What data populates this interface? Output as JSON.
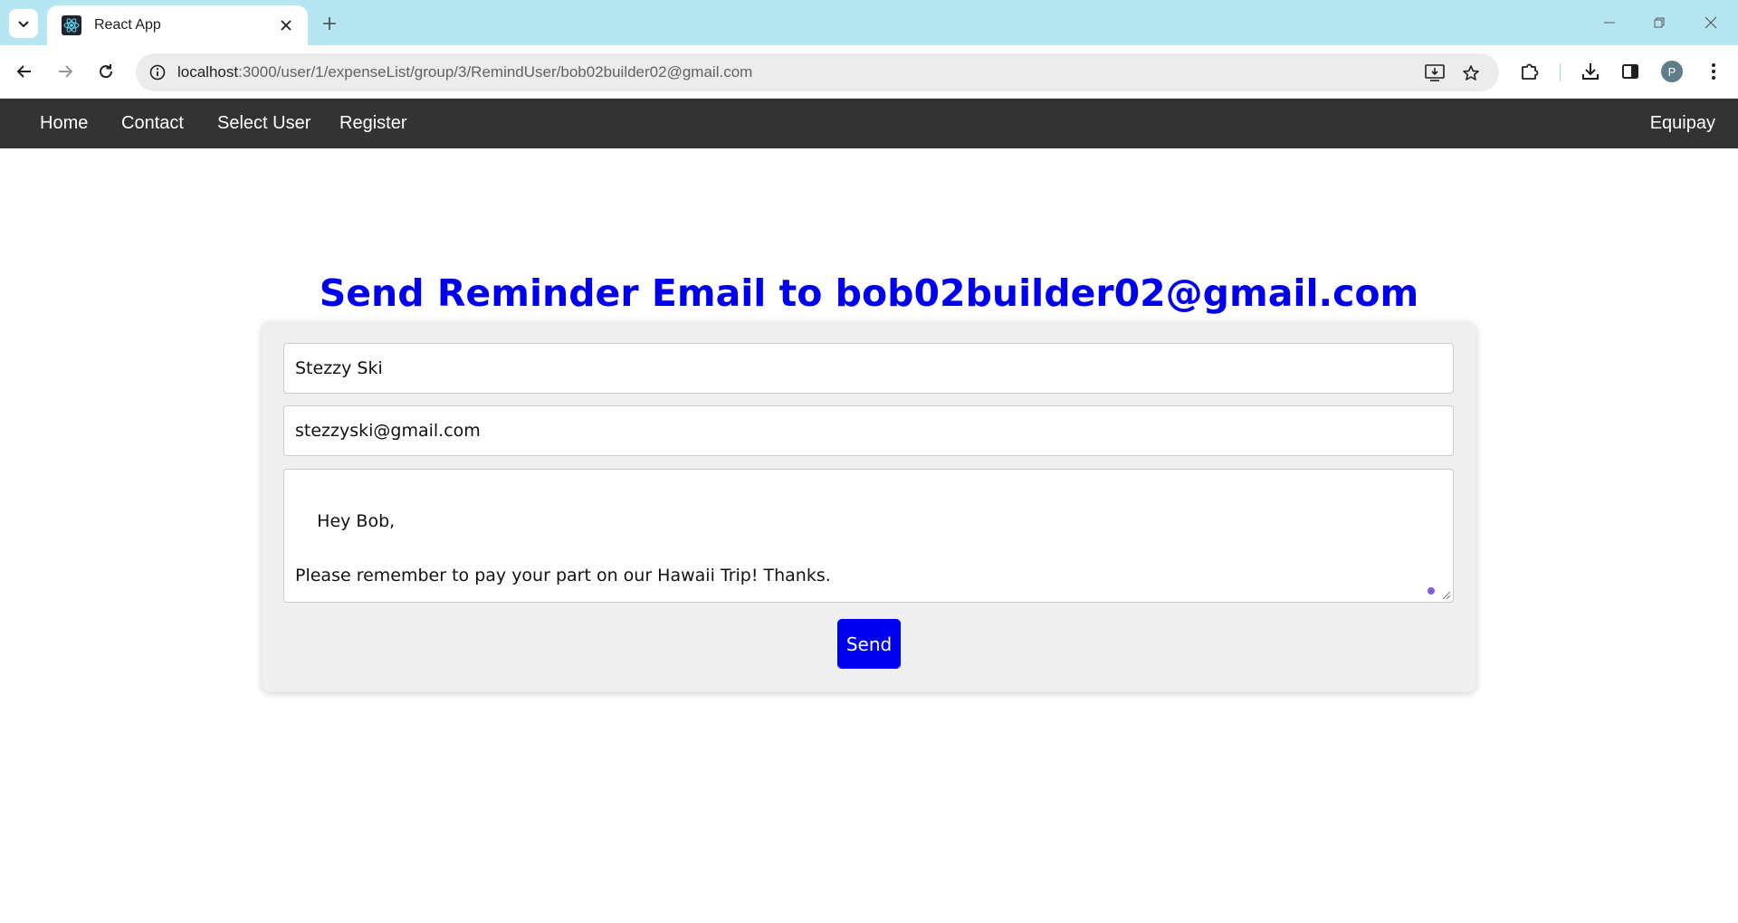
{
  "browser": {
    "tab_title": "React App",
    "url_host": "localhost",
    "url_path": ":3000/user/1/expenseList/group/3/RemindUser/bob02builder02@gmail.com",
    "profile_initial": "P",
    "colors": {
      "tabstrip": "#b6e6f2",
      "omnibox": "#ececec"
    }
  },
  "nav": {
    "links": [
      {
        "label": "Home"
      },
      {
        "label": "Contact"
      },
      {
        "label": "Select User"
      },
      {
        "label": "Register"
      }
    ],
    "brand": "Equipay",
    "background": "#333333"
  },
  "main": {
    "title": "Send Reminder Email to bob02builder02@gmail.com",
    "title_color": "#0000ee",
    "form": {
      "name_value": "Stezzy Ski",
      "email_value": "stezzyski@gmail.com",
      "message_value": "Hey Bob,\n\nPlease remember to pay your part on our Hawaii Trip! Thanks.",
      "send_label": "Send",
      "send_color": "#0000ee"
    }
  },
  "icons": {
    "tab_search": "chevron-down-icon",
    "favicon": "react-logo-icon",
    "tab_close": "close-icon",
    "new_tab": "plus-icon",
    "back": "arrow-left-icon",
    "forward": "arrow-right-icon",
    "reload": "reload-icon",
    "site_info": "info-icon",
    "install": "install-app-icon",
    "bookmark": "star-icon",
    "extensions": "puzzle-icon",
    "downloads": "download-icon",
    "side_panel": "side-panel-icon",
    "menu": "kebab-menu-icon"
  }
}
